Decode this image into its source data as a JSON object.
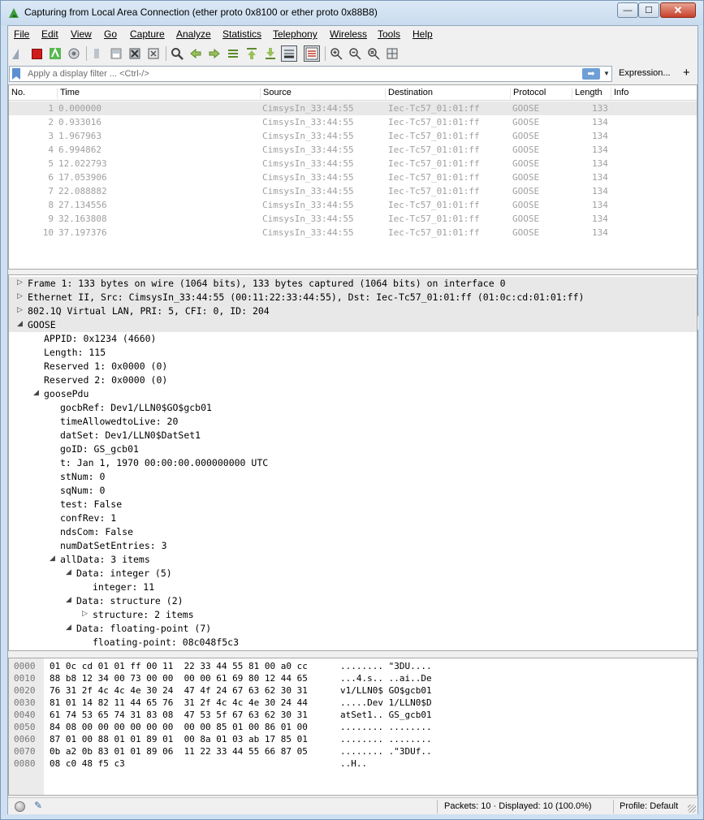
{
  "window": {
    "title": "Capturing from Local Area Connection (ether proto 0x8100 or ether proto 0x88B8)",
    "min_glyph": "—",
    "max_glyph": "☐",
    "close_glyph": "✕"
  },
  "menu": [
    "File",
    "Edit",
    "View",
    "Go",
    "Capture",
    "Analyze",
    "Statistics",
    "Telephony",
    "Wireless",
    "Tools",
    "Help"
  ],
  "toolbar": {
    "icons": [
      "shark-start-icon",
      "stop-capture-icon",
      "restart-capture-icon",
      "capture-options-icon",
      "open-file-icon",
      "save-file-icon",
      "close-file-icon",
      "reload-file-icon",
      "find-packet-icon",
      "go-back-icon",
      "go-forward-icon",
      "go-to-packet-icon",
      "first-packet-icon",
      "last-packet-icon",
      "autoscroll-icon",
      "colorize-icon",
      "zoom-in-icon",
      "zoom-out-icon",
      "normal-size-icon",
      "resize-columns-icon"
    ]
  },
  "filter": {
    "placeholder": "Apply a display filter ... <Ctrl-/>",
    "expression_label": "Expression...",
    "add_label": "+"
  },
  "packet_list": {
    "columns": [
      "No.",
      "Time",
      "Source",
      "Destination",
      "Protocol",
      "Length",
      "Info"
    ],
    "rows": [
      {
        "no": "1",
        "time": "0.000000",
        "src": "CimsysIn_33:44:55",
        "dst": "Iec-Tc57_01:01:ff",
        "proto": "GOOSE",
        "len": "133"
      },
      {
        "no": "2",
        "time": "0.933016",
        "src": "CimsysIn_33:44:55",
        "dst": "Iec-Tc57_01:01:ff",
        "proto": "GOOSE",
        "len": "134"
      },
      {
        "no": "3",
        "time": "1.967963",
        "src": "CimsysIn_33:44:55",
        "dst": "Iec-Tc57_01:01:ff",
        "proto": "GOOSE",
        "len": "134"
      },
      {
        "no": "4",
        "time": "6.994862",
        "src": "CimsysIn_33:44:55",
        "dst": "Iec-Tc57_01:01:ff",
        "proto": "GOOSE",
        "len": "134"
      },
      {
        "no": "5",
        "time": "12.022793",
        "src": "CimsysIn_33:44:55",
        "dst": "Iec-Tc57_01:01:ff",
        "proto": "GOOSE",
        "len": "134"
      },
      {
        "no": "6",
        "time": "17.053906",
        "src": "CimsysIn_33:44:55",
        "dst": "Iec-Tc57_01:01:ff",
        "proto": "GOOSE",
        "len": "134"
      },
      {
        "no": "7",
        "time": "22.088882",
        "src": "CimsysIn_33:44:55",
        "dst": "Iec-Tc57_01:01:ff",
        "proto": "GOOSE",
        "len": "134"
      },
      {
        "no": "8",
        "time": "27.134556",
        "src": "CimsysIn_33:44:55",
        "dst": "Iec-Tc57_01:01:ff",
        "proto": "GOOSE",
        "len": "134"
      },
      {
        "no": "9",
        "time": "32.163808",
        "src": "CimsysIn_33:44:55",
        "dst": "Iec-Tc57_01:01:ff",
        "proto": "GOOSE",
        "len": "134"
      },
      {
        "no": "10",
        "time": "37.197376",
        "src": "CimsysIn_33:44:55",
        "dst": "Iec-Tc57_01:01:ff",
        "proto": "GOOSE",
        "len": "134"
      }
    ]
  },
  "details": [
    {
      "indent": 0,
      "exp": "collapsed",
      "text": "Frame 1: 133 bytes on wire (1064 bits), 133 bytes captured (1064 bits) on interface 0"
    },
    {
      "indent": 0,
      "exp": "collapsed",
      "text": "Ethernet II, Src: CimsysIn_33:44:55 (00:11:22:33:44:55), Dst: Iec-Tc57_01:01:ff (01:0c:cd:01:01:ff)"
    },
    {
      "indent": 0,
      "exp": "collapsed",
      "text": "802.1Q Virtual LAN, PRI: 5, CFI: 0, ID: 204"
    },
    {
      "indent": 0,
      "exp": "expanded",
      "text": "GOOSE"
    },
    {
      "indent": 1,
      "exp": "none",
      "text": "APPID: 0x1234 (4660)"
    },
    {
      "indent": 1,
      "exp": "none",
      "text": "Length: 115"
    },
    {
      "indent": 1,
      "exp": "none",
      "text": "Reserved 1: 0x0000 (0)"
    },
    {
      "indent": 1,
      "exp": "none",
      "text": "Reserved 2: 0x0000 (0)"
    },
    {
      "indent": 1,
      "exp": "expanded",
      "text": "goosePdu"
    },
    {
      "indent": 2,
      "exp": "none",
      "text": "gocbRef: Dev1/LLN0$GO$gcb01"
    },
    {
      "indent": 2,
      "exp": "none",
      "text": "timeAllowedtoLive: 20"
    },
    {
      "indent": 2,
      "exp": "none",
      "text": "datSet: Dev1/LLN0$DatSet1"
    },
    {
      "indent": 2,
      "exp": "none",
      "text": "goID: GS_gcb01"
    },
    {
      "indent": 2,
      "exp": "none",
      "text": "t: Jan  1, 1970 00:00:00.000000000 UTC"
    },
    {
      "indent": 2,
      "exp": "none",
      "text": "stNum: 0"
    },
    {
      "indent": 2,
      "exp": "none",
      "text": "sqNum: 0"
    },
    {
      "indent": 2,
      "exp": "none",
      "text": "test: False"
    },
    {
      "indent": 2,
      "exp": "none",
      "text": "confRev: 1"
    },
    {
      "indent": 2,
      "exp": "none",
      "text": "ndsCom: False"
    },
    {
      "indent": 2,
      "exp": "none",
      "text": "numDatSetEntries: 3"
    },
    {
      "indent": 2,
      "exp": "expanded",
      "text": "allData: 3 items"
    },
    {
      "indent": 3,
      "exp": "expanded",
      "text": "Data: integer (5)"
    },
    {
      "indent": 4,
      "exp": "none",
      "text": "integer: 11"
    },
    {
      "indent": 3,
      "exp": "expanded",
      "text": "Data: structure (2)"
    },
    {
      "indent": 4,
      "exp": "collapsed",
      "text": "structure: 2 items"
    },
    {
      "indent": 3,
      "exp": "expanded",
      "text": "Data: floating-point (7)"
    },
    {
      "indent": 4,
      "exp": "none",
      "text": "floating-point: 08c048f5c3"
    }
  ],
  "bytes": [
    {
      "off": "0000",
      "hex": "01 0c cd 01 01 ff 00 11  22 33 44 55 81 00 a0 cc",
      "ascii": "........ \"3DU...."
    },
    {
      "off": "0010",
      "hex": "88 b8 12 34 00 73 00 00  00 00 61 69 80 12 44 65",
      "ascii": "...4.s.. ..ai..De"
    },
    {
      "off": "0020",
      "hex": "76 31 2f 4c 4c 4e 30 24  47 4f 24 67 63 62 30 31",
      "ascii": "v1/LLN0$ GO$gcb01"
    },
    {
      "off": "0030",
      "hex": "81 01 14 82 11 44 65 76  31 2f 4c 4c 4e 30 24 44",
      "ascii": ".....Dev 1/LLN0$D"
    },
    {
      "off": "0040",
      "hex": "61 74 53 65 74 31 83 08  47 53 5f 67 63 62 30 31",
      "ascii": "atSet1.. GS_gcb01"
    },
    {
      "off": "0050",
      "hex": "84 08 00 00 00 00 00 00  00 00 85 01 00 86 01 00",
      "ascii": "........ ........"
    },
    {
      "off": "0060",
      "hex": "87 01 00 88 01 01 89 01  00 8a 01 03 ab 17 85 01",
      "ascii": "........ ........"
    },
    {
      "off": "0070",
      "hex": "0b a2 0b 83 01 01 89 06  11 22 33 44 55 66 87 05",
      "ascii": "........ .\"3DUf.."
    },
    {
      "off": "0080",
      "hex": "08 c0 48 f5 c3",
      "ascii": "..H.."
    }
  ],
  "status": {
    "packets": "Packets: 10 · Displayed: 10 (100.0%)",
    "profile": "Profile: Default"
  },
  "colors": {
    "accent": "#6e9fd6",
    "stop": "#d11a1a",
    "selected_row": "#e8e8e8"
  }
}
